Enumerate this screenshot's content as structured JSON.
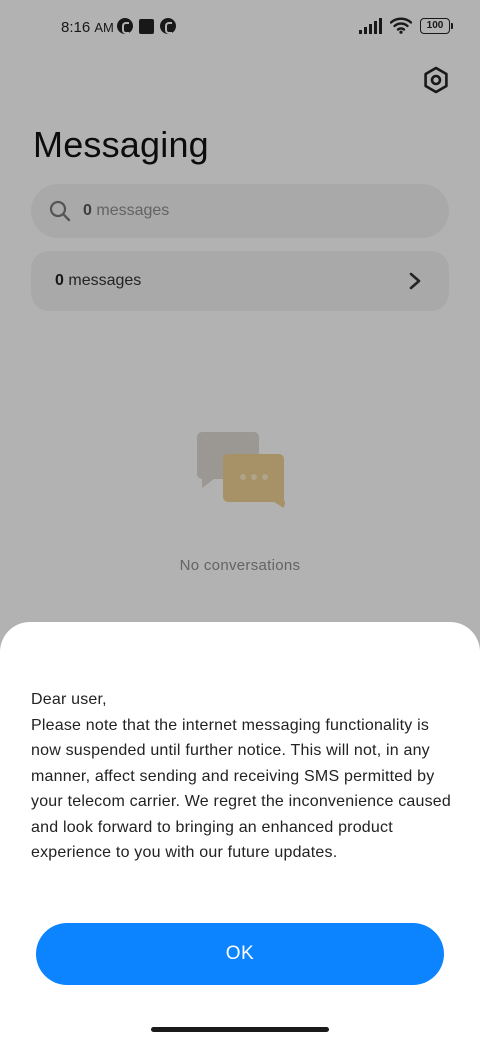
{
  "status_bar": {
    "time": "8:16",
    "ampm": "AM",
    "battery": "100"
  },
  "header": {
    "title": "Messaging"
  },
  "search": {
    "count": "0",
    "placeholder_suffix": "messages"
  },
  "messages_row": {
    "count": "0",
    "label": "messages"
  },
  "empty_state": {
    "text": "No conversations"
  },
  "dialog": {
    "greeting": "Dear user,",
    "body": "Please note that the internet messaging functionality is now suspended until further notice. This will not, in any manner, affect sending and receiving SMS permitted by your telecom carrier. We regret the inconvenience caused and look forward to bringing an enhanced product experience to you with our future updates.",
    "ok_label": "OK"
  },
  "colors": {
    "accent": "#0d84ff",
    "illustration_back": "#d7d3cc",
    "illustration_front": "#e8c98e"
  }
}
